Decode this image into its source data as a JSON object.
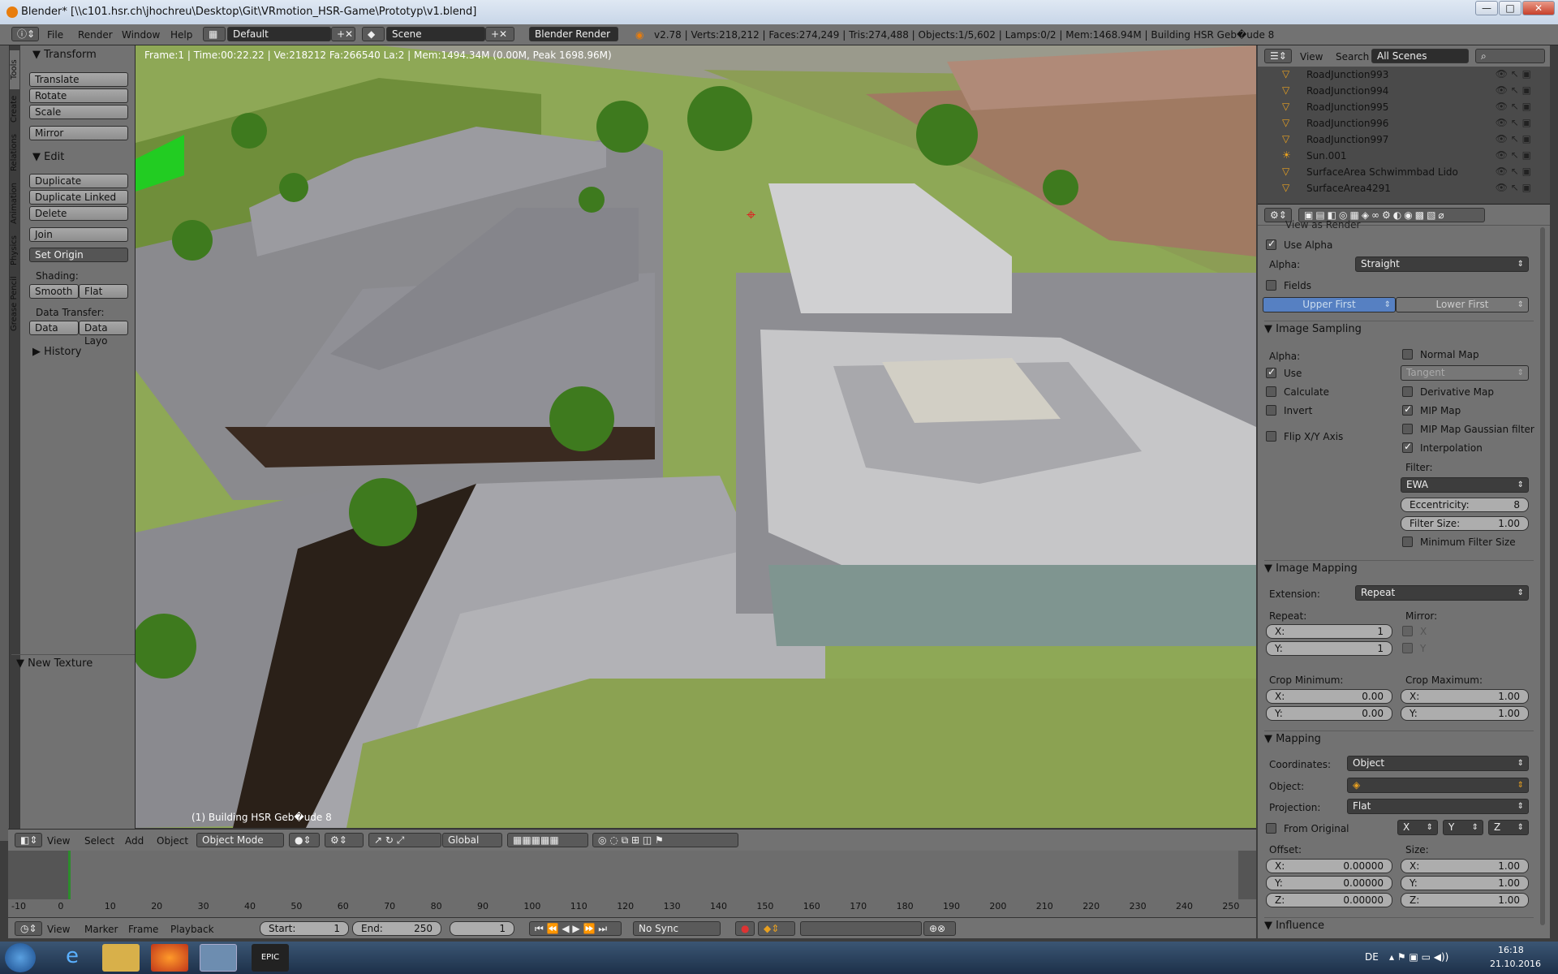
{
  "window": {
    "title": "Blender* [\\\\c101.hsr.ch\\jhochreu\\Desktop\\Git\\VRmotion_HSR-Game\\Prototyp\\v1.blend]",
    "min": "—",
    "max": "□",
    "close": "✕"
  },
  "info_header": {
    "menus": [
      "File",
      "Render",
      "Window",
      "Help"
    ],
    "screen_layout": "Default",
    "scene": "Scene",
    "render_engine": "Blender Render",
    "stats": "v2.78 | Verts:218,212 | Faces:274,249 | Tris:274,488 | Objects:1/5,602 | Lamps:0/2 | Mem:1468.94M | Building HSR Geb�ude 8"
  },
  "tool_tabs": [
    "Tools",
    "Create",
    "Relations",
    "Animation",
    "Physics",
    "Grease Pencil"
  ],
  "tool_shelf": {
    "transform": {
      "header": "Transform",
      "buttons": [
        "Translate",
        "Rotate",
        "Scale",
        "Mirror"
      ]
    },
    "edit": {
      "header": "Edit",
      "buttons": [
        "Duplicate",
        "Duplicate Linked",
        "Delete",
        "Join"
      ],
      "set_origin": "Set Origin",
      "shading_label": "Shading:",
      "smooth": "Smooth",
      "flat": "Flat",
      "data_transfer_label": "Data Transfer:",
      "data": "Data",
      "data_layout": "Data Layo"
    },
    "history": "History",
    "new_texture": "New Texture"
  },
  "viewport": {
    "info": "Frame:1 | Time:00:22.22 | Ve:218212 Fa:266540 La:2 | Mem:1494.34M (0.00M, Peak 1698.96M)",
    "object_label": "(1) Building HSR Geb�ude 8"
  },
  "view3d_header": {
    "menus": [
      "View",
      "Select",
      "Add",
      "Object"
    ],
    "mode": "Object Mode",
    "orientation": "Global"
  },
  "timeline": {
    "ticks": [
      "-10",
      "0",
      "10",
      "20",
      "30",
      "40",
      "50",
      "60",
      "70",
      "80",
      "90",
      "100",
      "110",
      "120",
      "130",
      "140",
      "150",
      "160",
      "170",
      "180",
      "190",
      "200",
      "210",
      "220",
      "230",
      "240",
      "250"
    ],
    "menus": [
      "View",
      "Marker",
      "Frame",
      "Playback"
    ],
    "start": "Start:",
    "start_val": "1",
    "end": "End:",
    "end_val": "250",
    "current": "1",
    "sync": "No Sync"
  },
  "outliner": {
    "menus": [
      "View",
      "Search"
    ],
    "filter": "All Scenes",
    "rows": [
      "RoadJunction993",
      "RoadJunction994",
      "RoadJunction995",
      "RoadJunction996",
      "RoadJunction997",
      "Sun.001",
      "SurfaceArea Schwimmbad Lido",
      "SurfaceArea4291"
    ]
  },
  "properties": {
    "view_as_render": "View as Render",
    "use_alpha": "Use Alpha",
    "alpha_label": "Alpha:",
    "alpha_value": "Straight",
    "fields": "Fields",
    "upper_first": "Upper First",
    "lower_first": "Lower First",
    "image_sampling": {
      "header": "Image Sampling",
      "alpha": "Alpha:",
      "use": "Use",
      "calculate": "Calculate",
      "invert": "Invert",
      "flip": "Flip X/Y Axis",
      "normal_map": "Normal Map",
      "tangent": "Tangent",
      "derivative_map": "Derivative Map",
      "mip_map": "MIP Map",
      "mip_gauss": "MIP Map Gaussian filter",
      "interpolation": "Interpolation",
      "filter_label": "Filter:",
      "filter_value": "EWA",
      "eccentricity": "Eccentricity:",
      "eccentricity_val": "8",
      "filter_size": "Filter Size:",
      "filter_size_val": "1.00",
      "min_filter": "Minimum Filter Size"
    },
    "image_mapping": {
      "header": "Image Mapping",
      "extension": "Extension:",
      "extension_val": "Repeat",
      "repeat": "Repeat:",
      "mirror": "Mirror:",
      "x": "X:",
      "y": "Y:",
      "rx": "1",
      "ry": "1",
      "mx": "X",
      "my": "Y",
      "crop_min": "Crop Minimum:",
      "crop_max": "Crop Maximum:",
      "cminx": "0.00",
      "cminy": "0.00",
      "cmaxx": "1.00",
      "cmaxy": "1.00"
    },
    "mapping": {
      "header": "Mapping",
      "coordinates": "Coordinates:",
      "coordinates_val": "Object",
      "object": "Object:",
      "projection": "Projection:",
      "projection_val": "Flat",
      "from_original": "From Original",
      "ax": "X",
      "ay": "Y",
      "az": "Z",
      "offset": "Offset:",
      "size": "Size:",
      "ox": "0.00000",
      "oy": "0.00000",
      "oz": "0.00000",
      "sx": "1.00",
      "sy": "1.00",
      "sz": "1.00",
      "z": "Z:"
    },
    "influence": "Influence"
  },
  "taskbar": {
    "lang": "DE",
    "time": "16:18",
    "date": "21.10.2016"
  }
}
